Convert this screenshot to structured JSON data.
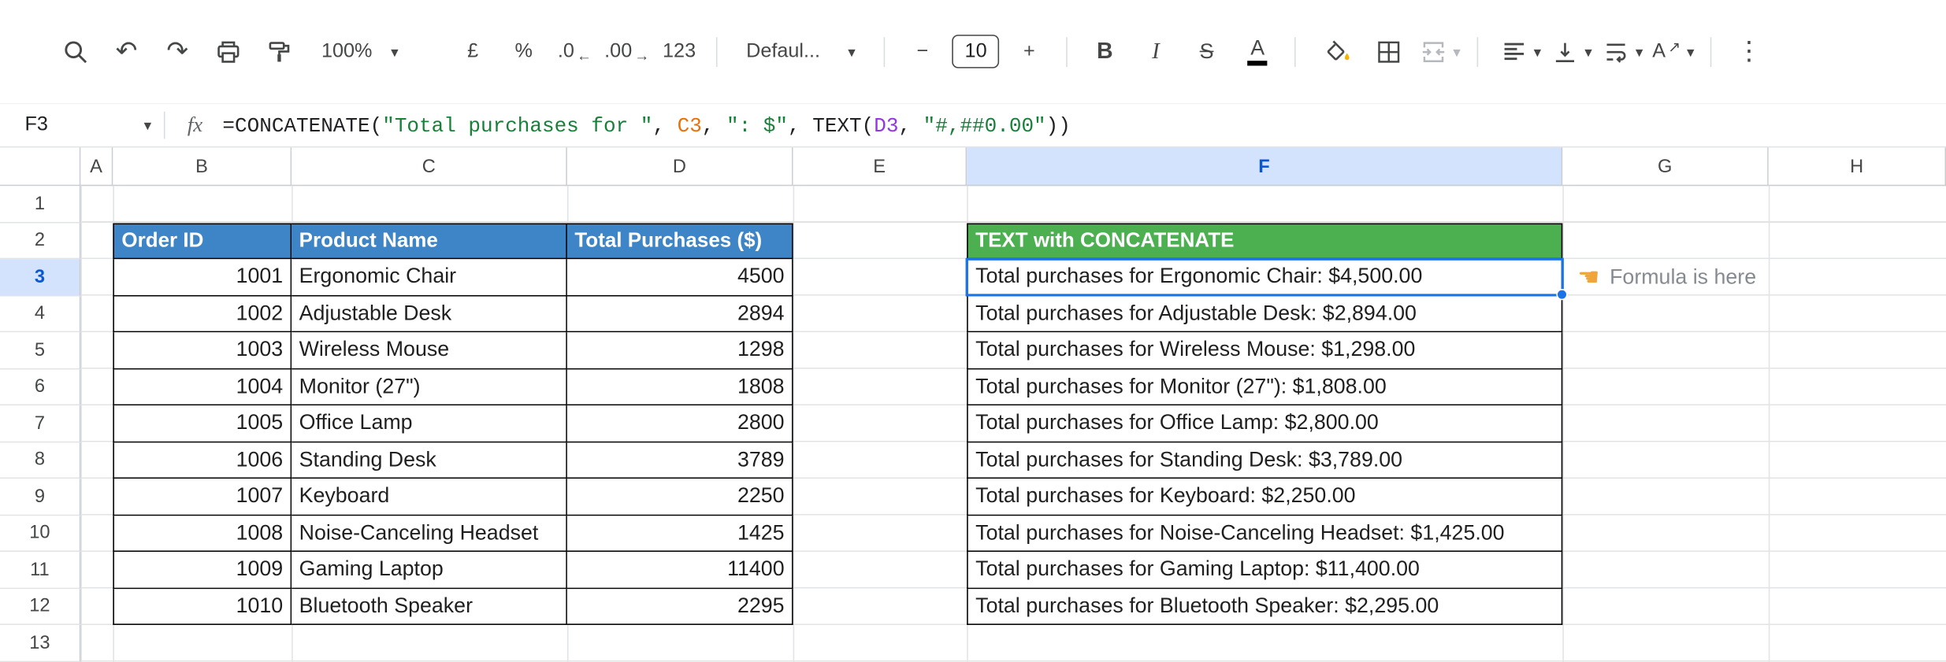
{
  "toolbar": {
    "zoom_value": "100%",
    "currency": "£",
    "percent": "%",
    "decrease_decimal": ".0",
    "increase_decimal": ".00",
    "more_formats": "123",
    "font_name": "Defaul...",
    "minus": "−",
    "font_size": "10",
    "plus": "+",
    "bold": "B",
    "italic": "I",
    "strikethrough": "S",
    "text_color": "A",
    "rotation_letter": "A"
  },
  "icons": {
    "undo": "↶",
    "redo": "↷",
    "caret": "▾",
    "more_vertical": "⋮",
    "decrease_arrow": "←",
    "increase_arrow": "→",
    "rotate_arrow": "↗"
  },
  "formula_bar": {
    "cell_reference": "F3",
    "fx": "fx",
    "formula_parts": [
      {
        "text": "=CONCATENATE(",
        "color": "#202124"
      },
      {
        "text": "\"Total purchases for \"",
        "color": "#188038"
      },
      {
        "text": ", ",
        "color": "#202124"
      },
      {
        "text": "C3",
        "color": "#e8710a"
      },
      {
        "text": ", ",
        "color": "#202124"
      },
      {
        "text": "\": $\"",
        "color": "#188038"
      },
      {
        "text": ", ",
        "color": "#202124"
      },
      {
        "text": "TEXT(",
        "color": "#202124"
      },
      {
        "text": "D3",
        "color": "#9334e6"
      },
      {
        "text": ", ",
        "color": "#202124"
      },
      {
        "text": "\"#,##0.00\"",
        "color": "#188038"
      },
      {
        "text": "))",
        "color": "#202124"
      }
    ]
  },
  "grid": {
    "column_letters": [
      "A",
      "B",
      "C",
      "D",
      "E",
      "F",
      "G",
      "H"
    ],
    "row_numbers": [
      "1",
      "2",
      "3",
      "4",
      "5",
      "6",
      "7",
      "8",
      "9",
      "10",
      "11",
      "12",
      "13"
    ],
    "selected_cell": "F3",
    "selected_column": "F",
    "selected_row": "3"
  },
  "table": {
    "header_order_id": "Order ID",
    "header_product": "Product Name",
    "header_total": "Total Purchases ($)",
    "header_text_concat": "TEXT with CONCATENATE",
    "rows": [
      {
        "order_id": "1001",
        "product": "Ergonomic Chair",
        "total": "4500",
        "concat": "Total purchases for Ergonomic Chair: $4,500.00"
      },
      {
        "order_id": "1002",
        "product": "Adjustable Desk",
        "total": "2894",
        "concat": "Total purchases for Adjustable Desk: $2,894.00"
      },
      {
        "order_id": "1003",
        "product": "Wireless Mouse",
        "total": "1298",
        "concat": "Total purchases for Wireless Mouse: $1,298.00"
      },
      {
        "order_id": "1004",
        "product": "Monitor (27\")",
        "total": "1808",
        "concat": "Total purchases for Monitor (27\"): $1,808.00"
      },
      {
        "order_id": "1005",
        "product": "Office Lamp",
        "total": "2800",
        "concat": "Total purchases for Office Lamp: $2,800.00"
      },
      {
        "order_id": "1006",
        "product": "Standing Desk",
        "total": "3789",
        "concat": "Total purchases for Standing Desk: $3,789.00"
      },
      {
        "order_id": "1007",
        "product": "Keyboard",
        "total": "2250",
        "concat": "Total purchases for Keyboard: $2,250.00"
      },
      {
        "order_id": "1008",
        "product": "Noise-Canceling Headset",
        "total": "1425",
        "concat": "Total purchases for Noise-Canceling Headset: $1,425.00"
      },
      {
        "order_id": "1009",
        "product": "Gaming Laptop",
        "total": "11400",
        "concat": "Total purchases for Gaming Laptop: $11,400.00"
      },
      {
        "order_id": "1010",
        "product": "Bluetooth Speaker",
        "total": "2295",
        "concat": "Total purchases for Bluetooth Speaker: $2,295.00"
      }
    ]
  },
  "annotation": {
    "icon": "☚",
    "text": "Formula is here"
  },
  "colors": {
    "table_header_blue": "#3d85c6",
    "text_header_green": "#4caf50",
    "selection_blue": "#1a73e8",
    "selected_header_bg": "#d3e3fd",
    "string_token_green": "#188038",
    "ref_token_orange": "#e8710a",
    "ref_token_purple": "#9334e6",
    "fill_color_yellow": "#f4b400",
    "annotation_gray": "#858b91"
  }
}
